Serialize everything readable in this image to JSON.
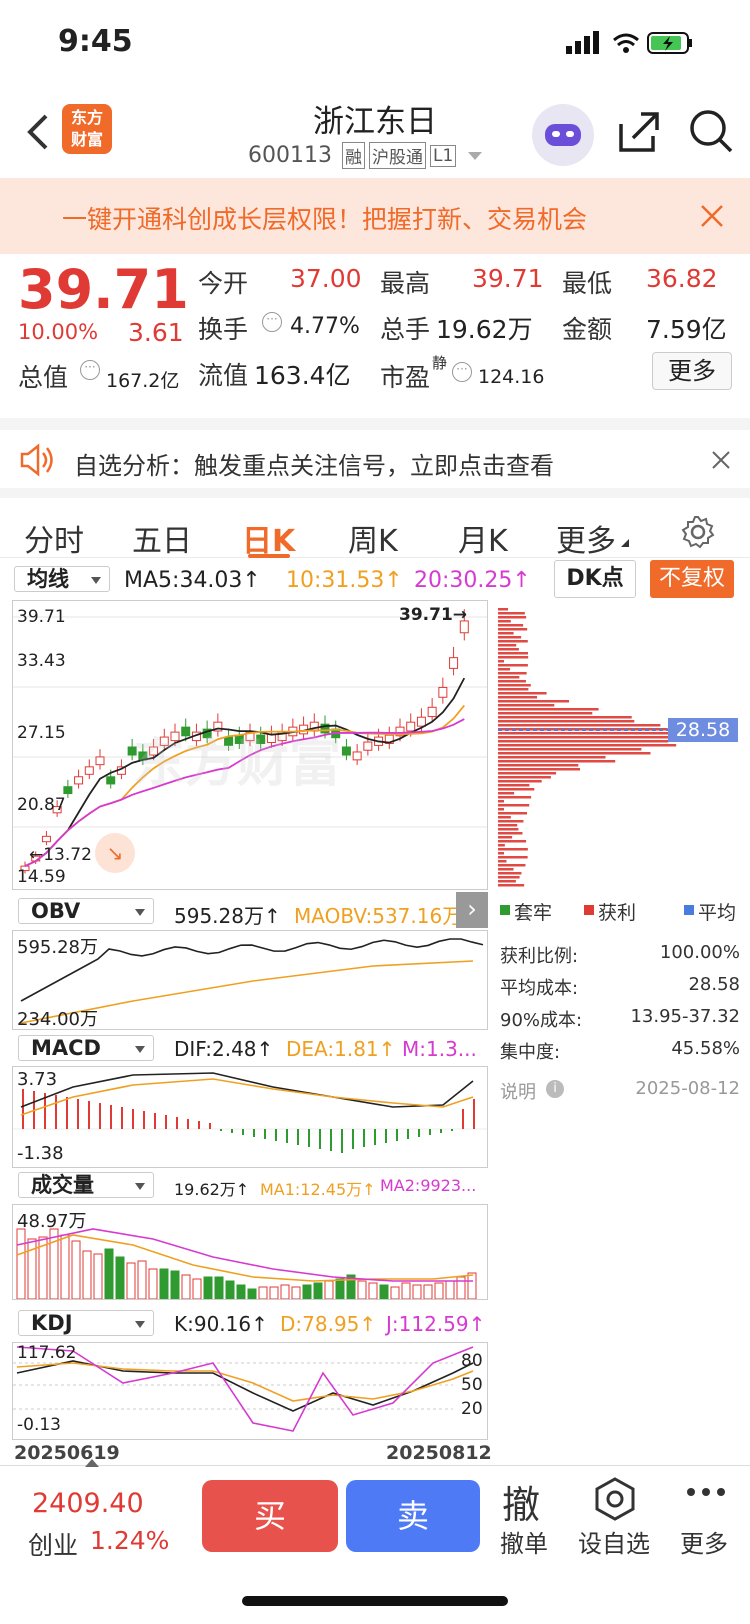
{
  "status_bar": {
    "time": "9:45"
  },
  "header": {
    "title": "浙江东日",
    "code": "600113",
    "badges": [
      "融",
      "沪股通",
      "L1"
    ],
    "logo_text_1": "东方",
    "logo_text_2": "财富"
  },
  "banner": {
    "text": "一键开通科创成长层权限！把握打新、交易机会"
  },
  "quote": {
    "price": "39.71",
    "change_pct": "10.00%",
    "change": "3.61",
    "open_label": "今开",
    "open": "37.00",
    "high_label": "最高",
    "high": "39.71",
    "low_label": "最低",
    "low": "36.82",
    "turnover_label": "换手",
    "turnover": "4.77%",
    "volume_label": "总手",
    "volume": "19.62万",
    "amount_label": "金额",
    "amount": "7.59亿",
    "mktcap_label": "总值",
    "mktcap": "167.2亿",
    "float_label": "流值",
    "float_cap": "163.4亿",
    "pe_label": "市盈",
    "pe_sup": "静",
    "pe": "124.16",
    "more": "更多"
  },
  "alert": {
    "text": "自选分析：触发重点关注信号，立即点击查看"
  },
  "tabs": [
    "分时",
    "五日",
    "日K",
    "周K",
    "月K",
    "更多"
  ],
  "chart_header": {
    "ma_select": "均线",
    "ma5": "MA5:34.03↑",
    "ma10": "10:31.53↑",
    "ma20": "20:30.25↑",
    "dk": "DK点",
    "fq": "不复权"
  },
  "main_chart": {
    "y_labels": [
      "39.71",
      "33.43",
      "27.15",
      "20.87",
      "14.59"
    ],
    "last_price_note": "39.71→",
    "low_note": "←13.72",
    "watermark": "东方财富",
    "cost_marker": "28.58"
  },
  "obv": {
    "select": "OBV",
    "value": "595.28万↑",
    "maobv": "MAOBV:537.16万",
    "ymax": "595.28万",
    "ymin": "234.00万"
  },
  "macd": {
    "select": "MACD",
    "dif": "DIF:2.48↑",
    "dea": "DEA:1.81↑",
    "m": "M:1.3...",
    "ymax": "3.73",
    "ymin": "-1.38"
  },
  "vol": {
    "select": "成交量",
    "value": "19.62万↑",
    "ma1": "MA1:12.45万↑",
    "ma2": "MA2:9923...",
    "ymax": "48.97万"
  },
  "kdj": {
    "select": "KDJ",
    "k": "K:90.16↑",
    "d": "D:78.95↑",
    "j": "J:112.59↑",
    "ymax": "117.62",
    "ymin": "-0.13",
    "levels": [
      "80",
      "50",
      "20"
    ]
  },
  "dates": {
    "start": "20250619",
    "end": "20250812"
  },
  "chip": {
    "legend": [
      "套牢",
      "获利",
      "平均"
    ],
    "rows": [
      {
        "label": "获利比例:",
        "value": "100.00%"
      },
      {
        "label": "平均成本:",
        "value": "28.58"
      },
      {
        "label": "90%成本:",
        "value": "13.95-37.32"
      },
      {
        "label": "集中度:",
        "value": "45.58%"
      }
    ],
    "note": "说明",
    "date": "2025-08-12"
  },
  "bottom": {
    "index_value": "2409.40",
    "index_name": "创业",
    "index_pct": "1.24%",
    "buy": "买",
    "sell": "卖",
    "cancel_icon": "撤",
    "cancel": "撤单",
    "watch": "设自选",
    "more": "更多"
  },
  "colors": {
    "up": "#e03a35",
    "down": "#2f9a2f",
    "accent": "#f06a2a",
    "ma10": "#f0a020",
    "ma20": "#d63ad0"
  }
}
